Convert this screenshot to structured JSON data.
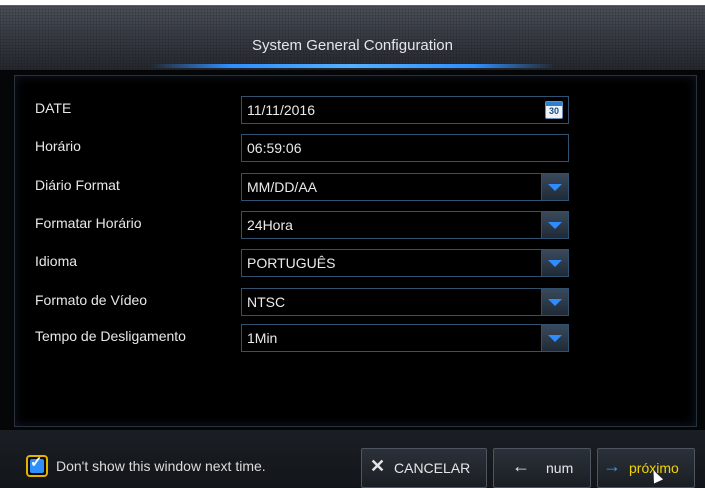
{
  "window": {
    "title": "System General Configuration"
  },
  "fields": [
    {
      "label": "DATE",
      "value": "11/11/2016",
      "type": "date",
      "icon": "calendar-icon",
      "icon_text": "30"
    },
    {
      "label": "Horário",
      "value": "06:59:06",
      "type": "text"
    },
    {
      "label": "Diário Format",
      "value": "MM/DD/AA",
      "type": "select"
    },
    {
      "label": "Formatar Horário",
      "value": "24Hora",
      "type": "select"
    },
    {
      "label": "Idioma",
      "value": "PORTUGUÊS",
      "type": "select"
    },
    {
      "label": "Formato de Vídeo",
      "value": "NTSC",
      "type": "select"
    },
    {
      "label": "Tempo de Desligamento",
      "value": "1Min",
      "type": "select"
    }
  ],
  "footer": {
    "checkbox_label": "Don't show this window next time.",
    "checkbox_checked": true,
    "cancel_label": "CANCELAR",
    "cancel_icon": "x-icon",
    "prev_label": "num",
    "prev_icon": "arrow-left-icon",
    "next_label": "próximo",
    "next_icon": "arrow-right-icon"
  },
  "colors": {
    "accent_blue": "#2f8fff",
    "next_label_yellow": "#f2d500",
    "checkbox_border": "#e0b400"
  }
}
